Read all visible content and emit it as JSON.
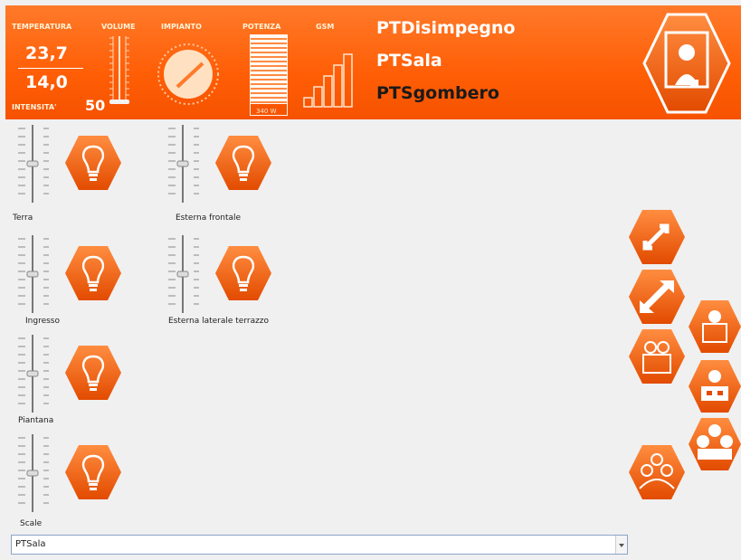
{
  "header": {
    "temperature_label": "TEMPERATURA",
    "volume_label": "VOLUME",
    "impianto_label": "IMPIANTO",
    "potenza_label": "POTENZA",
    "gsm_label": "GSM",
    "temp_current": "23,7",
    "temp_set": "14,0",
    "intensity_label": "INTENSITA'",
    "intensity_value": "50",
    "power_value": "340 W",
    "rooms": [
      "PTDisimpegno",
      "PTSala",
      "PTSgombero"
    ],
    "selected_room": "PTSgombero"
  },
  "lights": [
    {
      "label": "Terra"
    },
    {
      "label": "Esterna frontale"
    },
    {
      "label": "Ingresso"
    },
    {
      "label": "Esterna laterale terrazzo"
    },
    {
      "label": "Piantana"
    },
    {
      "label": "Scale"
    }
  ],
  "room_selector": {
    "value": "PTSala"
  },
  "colors": {
    "accent": "#ff6a10",
    "dark": "#d24600"
  },
  "icons": [
    "light-bulb-icon",
    "expand-icon",
    "collapse-icon",
    "people-icon",
    "person-icon",
    "group-icon",
    "camera-icon"
  ]
}
